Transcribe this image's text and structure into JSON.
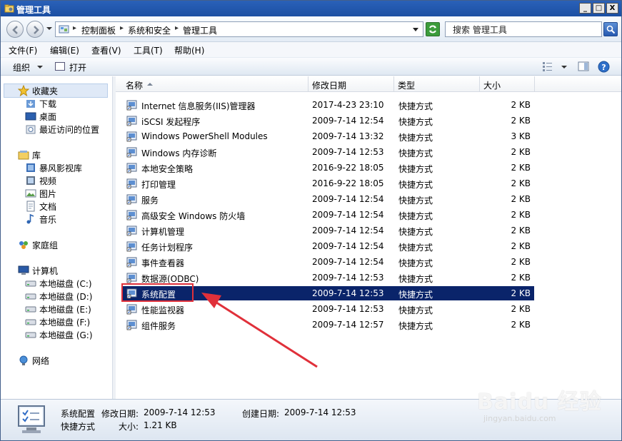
{
  "window": {
    "title": "管理工具",
    "minimize": "_",
    "maximize": "□",
    "close": "X"
  },
  "address": {
    "breadcrumbs": [
      "控制面板",
      "系统和安全",
      "管理工具"
    ],
    "search_value": "搜索 管理工具"
  },
  "menu": [
    "文件(F)",
    "编辑(E)",
    "查看(V)",
    "工具(T)",
    "帮助(H)"
  ],
  "toolbar": {
    "organize": "组织",
    "open": "打开"
  },
  "nav": {
    "favorites": "收藏夹",
    "downloads": "下载",
    "desktop": "桌面",
    "recent": "最近访问的位置",
    "libraries": "库",
    "storm": "暴风影视库",
    "video": "视频",
    "pictures": "图片",
    "documents": "文档",
    "music": "音乐",
    "homegroup": "家庭组",
    "computer": "计算机",
    "drives": [
      "本地磁盘 (C:)",
      "本地磁盘 (D:)",
      "本地磁盘 (E:)",
      "本地磁盘 (F:)",
      "本地磁盘 (G:)"
    ],
    "network": "网络"
  },
  "columns": {
    "name": "名称",
    "modified": "修改日期",
    "type": "类型",
    "size": "大小"
  },
  "files": [
    {
      "name": "Internet 信息服务(IIS)管理器",
      "date": "2017-4-23 23:10",
      "type": "快捷方式",
      "size": "2 KB",
      "icon": "iis-icon"
    },
    {
      "name": "iSCSI 发起程序",
      "date": "2009-7-14 12:54",
      "type": "快捷方式",
      "size": "2 KB",
      "icon": "iscsi-icon"
    },
    {
      "name": "Windows PowerShell Modules",
      "date": "2009-7-14 13:32",
      "type": "快捷方式",
      "size": "3 KB",
      "icon": "powershell-icon"
    },
    {
      "name": "Windows 内存诊断",
      "date": "2009-7-14 12:53",
      "type": "快捷方式",
      "size": "2 KB",
      "icon": "memory-diagnostic-icon"
    },
    {
      "name": "本地安全策略",
      "date": "2016-9-22 18:05",
      "type": "快捷方式",
      "size": "2 KB",
      "icon": "security-policy-icon"
    },
    {
      "name": "打印管理",
      "date": "2016-9-22 18:05",
      "type": "快捷方式",
      "size": "2 KB",
      "icon": "print-management-icon"
    },
    {
      "name": "服务",
      "date": "2009-7-14 12:54",
      "type": "快捷方式",
      "size": "2 KB",
      "icon": "services-icon"
    },
    {
      "name": "高级安全 Windows 防火墙",
      "date": "2009-7-14 12:54",
      "type": "快捷方式",
      "size": "2 KB",
      "icon": "firewall-icon"
    },
    {
      "name": "计算机管理",
      "date": "2009-7-14 12:54",
      "type": "快捷方式",
      "size": "2 KB",
      "icon": "computer-management-icon"
    },
    {
      "name": "任务计划程序",
      "date": "2009-7-14 12:54",
      "type": "快捷方式",
      "size": "2 KB",
      "icon": "task-scheduler-icon"
    },
    {
      "name": "事件查看器",
      "date": "2009-7-14 12:54",
      "type": "快捷方式",
      "size": "2 KB",
      "icon": "event-viewer-icon"
    },
    {
      "name": "数据源(ODBC)",
      "date": "2009-7-14 12:53",
      "type": "快捷方式",
      "size": "2 KB",
      "icon": "odbc-icon"
    },
    {
      "name": "系统配置",
      "date": "2009-7-14 12:53",
      "type": "快捷方式",
      "size": "2 KB",
      "icon": "msconfig-icon",
      "selected": true
    },
    {
      "name": "性能监视器",
      "date": "2009-7-14 12:53",
      "type": "快捷方式",
      "size": "2 KB",
      "icon": "performance-monitor-icon"
    },
    {
      "name": "组件服务",
      "date": "2009-7-14 12:57",
      "type": "快捷方式",
      "size": "2 KB",
      "icon": "component-services-icon"
    }
  ],
  "details": {
    "name": "系统配置",
    "modified_label": "修改日期:",
    "modified_value": "2009-7-14 12:53",
    "created_label": "创建日期:",
    "created_value": "2009-7-14 12:53",
    "type": "快捷方式",
    "size_label": "大小:",
    "size_value": "1.21 KB"
  },
  "watermark": {
    "brand": "Baidu 经验",
    "url": "jingyan.baidu.com"
  },
  "colors": {
    "selection": "#0a246a",
    "highlight_box": "#e0303a",
    "arrow": "#e0303a",
    "titlebar": "#1b4fa3"
  }
}
